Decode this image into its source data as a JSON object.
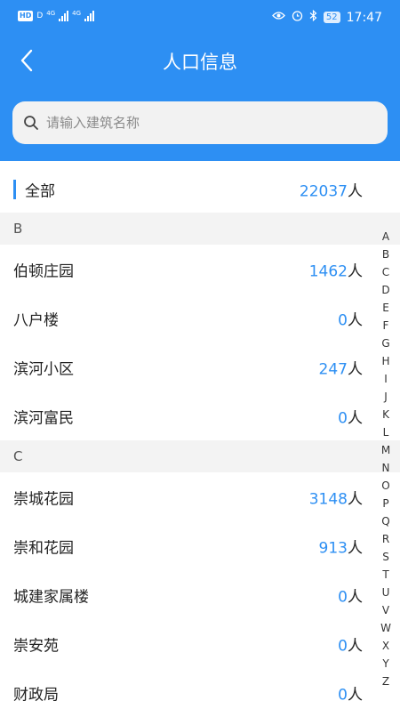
{
  "status_bar": {
    "left_badge": "HD",
    "left_badge2": "D",
    "network1": "4G",
    "network2": "4G",
    "battery": "52",
    "time": "17:47"
  },
  "header": {
    "title": "人口信息"
  },
  "search": {
    "placeholder": "请输入建筑名称",
    "value": ""
  },
  "unit": "人",
  "all": {
    "label": "全部",
    "count": "22037"
  },
  "sections": [
    {
      "letter": "B",
      "items": [
        {
          "name": "伯顿庄园",
          "count": "1462"
        },
        {
          "name": "八户楼",
          "count": "0"
        },
        {
          "name": "滨河小区",
          "count": "247"
        },
        {
          "name": "滨河富民",
          "count": "0"
        }
      ]
    },
    {
      "letter": "C",
      "items": [
        {
          "name": "崇城花园",
          "count": "3148"
        },
        {
          "name": "崇和花园",
          "count": "913"
        },
        {
          "name": "城建家属楼",
          "count": "0"
        },
        {
          "name": "崇安苑",
          "count": "0"
        },
        {
          "name": "财政局",
          "count": "0"
        }
      ]
    }
  ],
  "index_letters": [
    "A",
    "B",
    "C",
    "D",
    "E",
    "F",
    "G",
    "H",
    "I",
    "J",
    "K",
    "L",
    "M",
    "N",
    "O",
    "P",
    "Q",
    "R",
    "S",
    "T",
    "U",
    "V",
    "W",
    "X",
    "Y",
    "Z"
  ],
  "colors": {
    "primary": "#2d8ff3",
    "section_bg": "#f3f3f3",
    "text": "#222222"
  }
}
